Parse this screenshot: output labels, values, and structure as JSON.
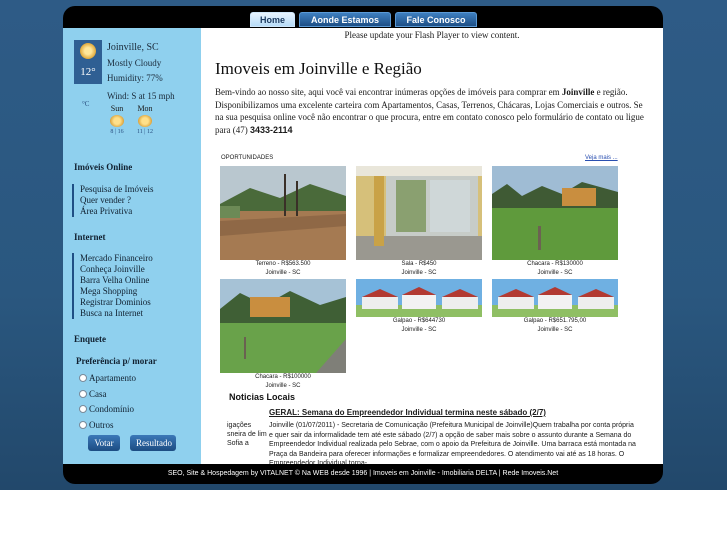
{
  "nav": {
    "tabs": [
      {
        "label": "Home",
        "active": true
      },
      {
        "label": "Aonde Estamos",
        "active": false
      },
      {
        "label": "Fale Conosco",
        "active": false
      }
    ]
  },
  "weather": {
    "city": "Joinville, SC",
    "temp": "12°",
    "condition": "Mostly Cloudy",
    "humidity": "Humidity: 77%",
    "wind": "Wind: S at 15 mph",
    "unit": "°C",
    "forecast": [
      {
        "day": "Sun",
        "range": "8 | 16",
        "icon": "partly-sunny-icon"
      },
      {
        "day": "Mon",
        "range": "11 | 12",
        "icon": "sunny-icon"
      }
    ]
  },
  "sidebar": {
    "imoveis_title": "Imóveis Online",
    "imoveis_links": [
      "Pesquisa de Imóveis",
      "Quer vender ?",
      "Área Privativa"
    ],
    "internet_title": "Internet",
    "internet_links": [
      "Mercado Financeiro",
      "Conheça Joinville",
      "Barra Velha Online",
      "Mega Shopping",
      "Registrar Dominios",
      "Busca na Internet"
    ],
    "enquete_title": "Enquete",
    "poll_question": "Preferência p/ morar",
    "poll_options": [
      "Apartamento",
      "Casa",
      "Condomínio",
      "Outros"
    ],
    "vote_label": "Votar",
    "result_label": "Resultado"
  },
  "main": {
    "flash_msg": "Please update your Flash Player to view content.",
    "title": "Imoveis em Joinville e Região",
    "intro_1": "Bem-vindo ao nosso site, aqui você vai encontrar inúmeras opções de imóveis para comprar em ",
    "intro_city": "Joinville",
    "intro_2": " e região. Disponibilizamos uma excelente carteira com Apartamentos, Casas, Terrenos, Chácaras, Lojas Comerciais e outros. Se na sua pesquisa online você não encontrar o que procura, entre em contato conosco pelo formulário de contato ou ligue para (47) ",
    "intro_phone": "3433-2114",
    "opportunities_label": "OPORTUNIDADES",
    "see_more": "Veja mais ...",
    "properties": [
      {
        "type": "Terreno",
        "price": "Terreno - R$563.500",
        "city": "Joinville - SC",
        "photo": "land"
      },
      {
        "type": "Sala",
        "price": "Sala - R$450",
        "city": "Joinville - SC",
        "photo": "room"
      },
      {
        "type": "Chacara",
        "price": "Chacara - R$130000",
        "city": "Joinville - SC",
        "photo": "farm"
      },
      {
        "type": "Chacara",
        "price": "Chacara - R$100000",
        "city": "Joinville - SC",
        "photo": "farm2"
      },
      {
        "type": "Galpao",
        "price": "Galpao - R$644730",
        "city": "Joinville - SC",
        "photo": "warehouse"
      },
      {
        "type": "Galpao",
        "price": "Galpao - R$651.795,00",
        "city": "Joinville - SC",
        "photo": "warehouse"
      }
    ],
    "news_title_label": "Noticias Locais",
    "news_left": "igações sneira de lim Sofia a",
    "news_headline": "GERAL: Semana do Empreendedor Individual termina neste sábado (2/7)",
    "news_body": "Joinville (01/07/2011) - Secretaria de Comunicação (Prefeitura Municipal de Joinville)Quem trabalha por conta própria e quer sair da informalidade tem até este sábado (2/7) a opção de saber mais sobre o assunto durante a Semana do Empreendedor Individual realizada pelo Sebrae, com o apoio da Prefeitura de Joinville. Uma barraca está montada na Praça da Bandeira para oferecer informações e formalizar empreendedores. O atendimento vai até as 18 horas. O Empreendedor Individual torna-..."
  },
  "footer": {
    "text": "SEO, Site & Hospedagem by VITALNET © Na WEB desde 1996 | Imoveis em Joinville - Imobiliaria DELTA | Rede Imoveis.Net"
  },
  "colors": {
    "sidebar": "#8fd0ee",
    "accent": "#1f4f85",
    "frame": "#000000"
  }
}
